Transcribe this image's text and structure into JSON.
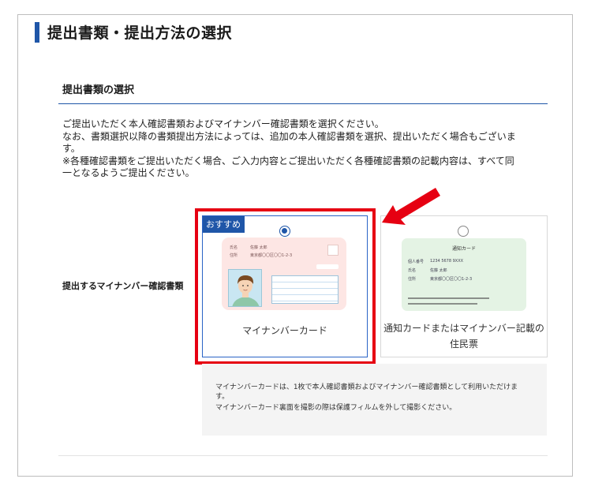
{
  "header": {
    "title": "提出書類・提出方法の選択"
  },
  "section": {
    "title": "提出書類の選択",
    "desc_lines": [
      "ご提出いただく本人確認書類およびマイナンバー確認書類を選択ください。",
      "なお、書類選択以降の書類提出方法によっては、追加の本人確認書類を選択、提出いただく場合もございま",
      "す。",
      "※各種確認書類をご提出いただく場合、ご入力内容とご提出いただく各種確認書類の記載内容は、すべて同",
      "一となるようご提出ください。"
    ],
    "row_label": "提出するマイナンバー確認書類"
  },
  "options": [
    {
      "badge": "おすすめ",
      "label": "マイナンバーカード",
      "selected": true,
      "image": {
        "name_label": "氏名",
        "name_value": "佐藤 太郎",
        "address_label": "住所",
        "address_value": "東京都〇〇区〇〇1-2-3"
      }
    },
    {
      "label_line1": "通知カードまたはマイナンバー記載の",
      "label_line2": "住民票",
      "selected": false,
      "image": {
        "title": "通知カード",
        "number_label": "個人番号",
        "number_value": "1234 5678 9XXX",
        "name_label": "氏名",
        "name_value": "佐藤 太郎",
        "address_label": "住所",
        "address_value": "東京都〇〇区〇〇1-2-3"
      }
    }
  ],
  "info_lines": [
    "マイナンバーカードは、1枚で本人確認書類およびマイナンバー確認書類として利用いただけま",
    "す。",
    "マイナンバーカード裏面を撮影の際は保護フィルムを外して撮影ください。"
  ],
  "colors": {
    "accent": "#1f56a8",
    "highlight": "#e60012"
  }
}
